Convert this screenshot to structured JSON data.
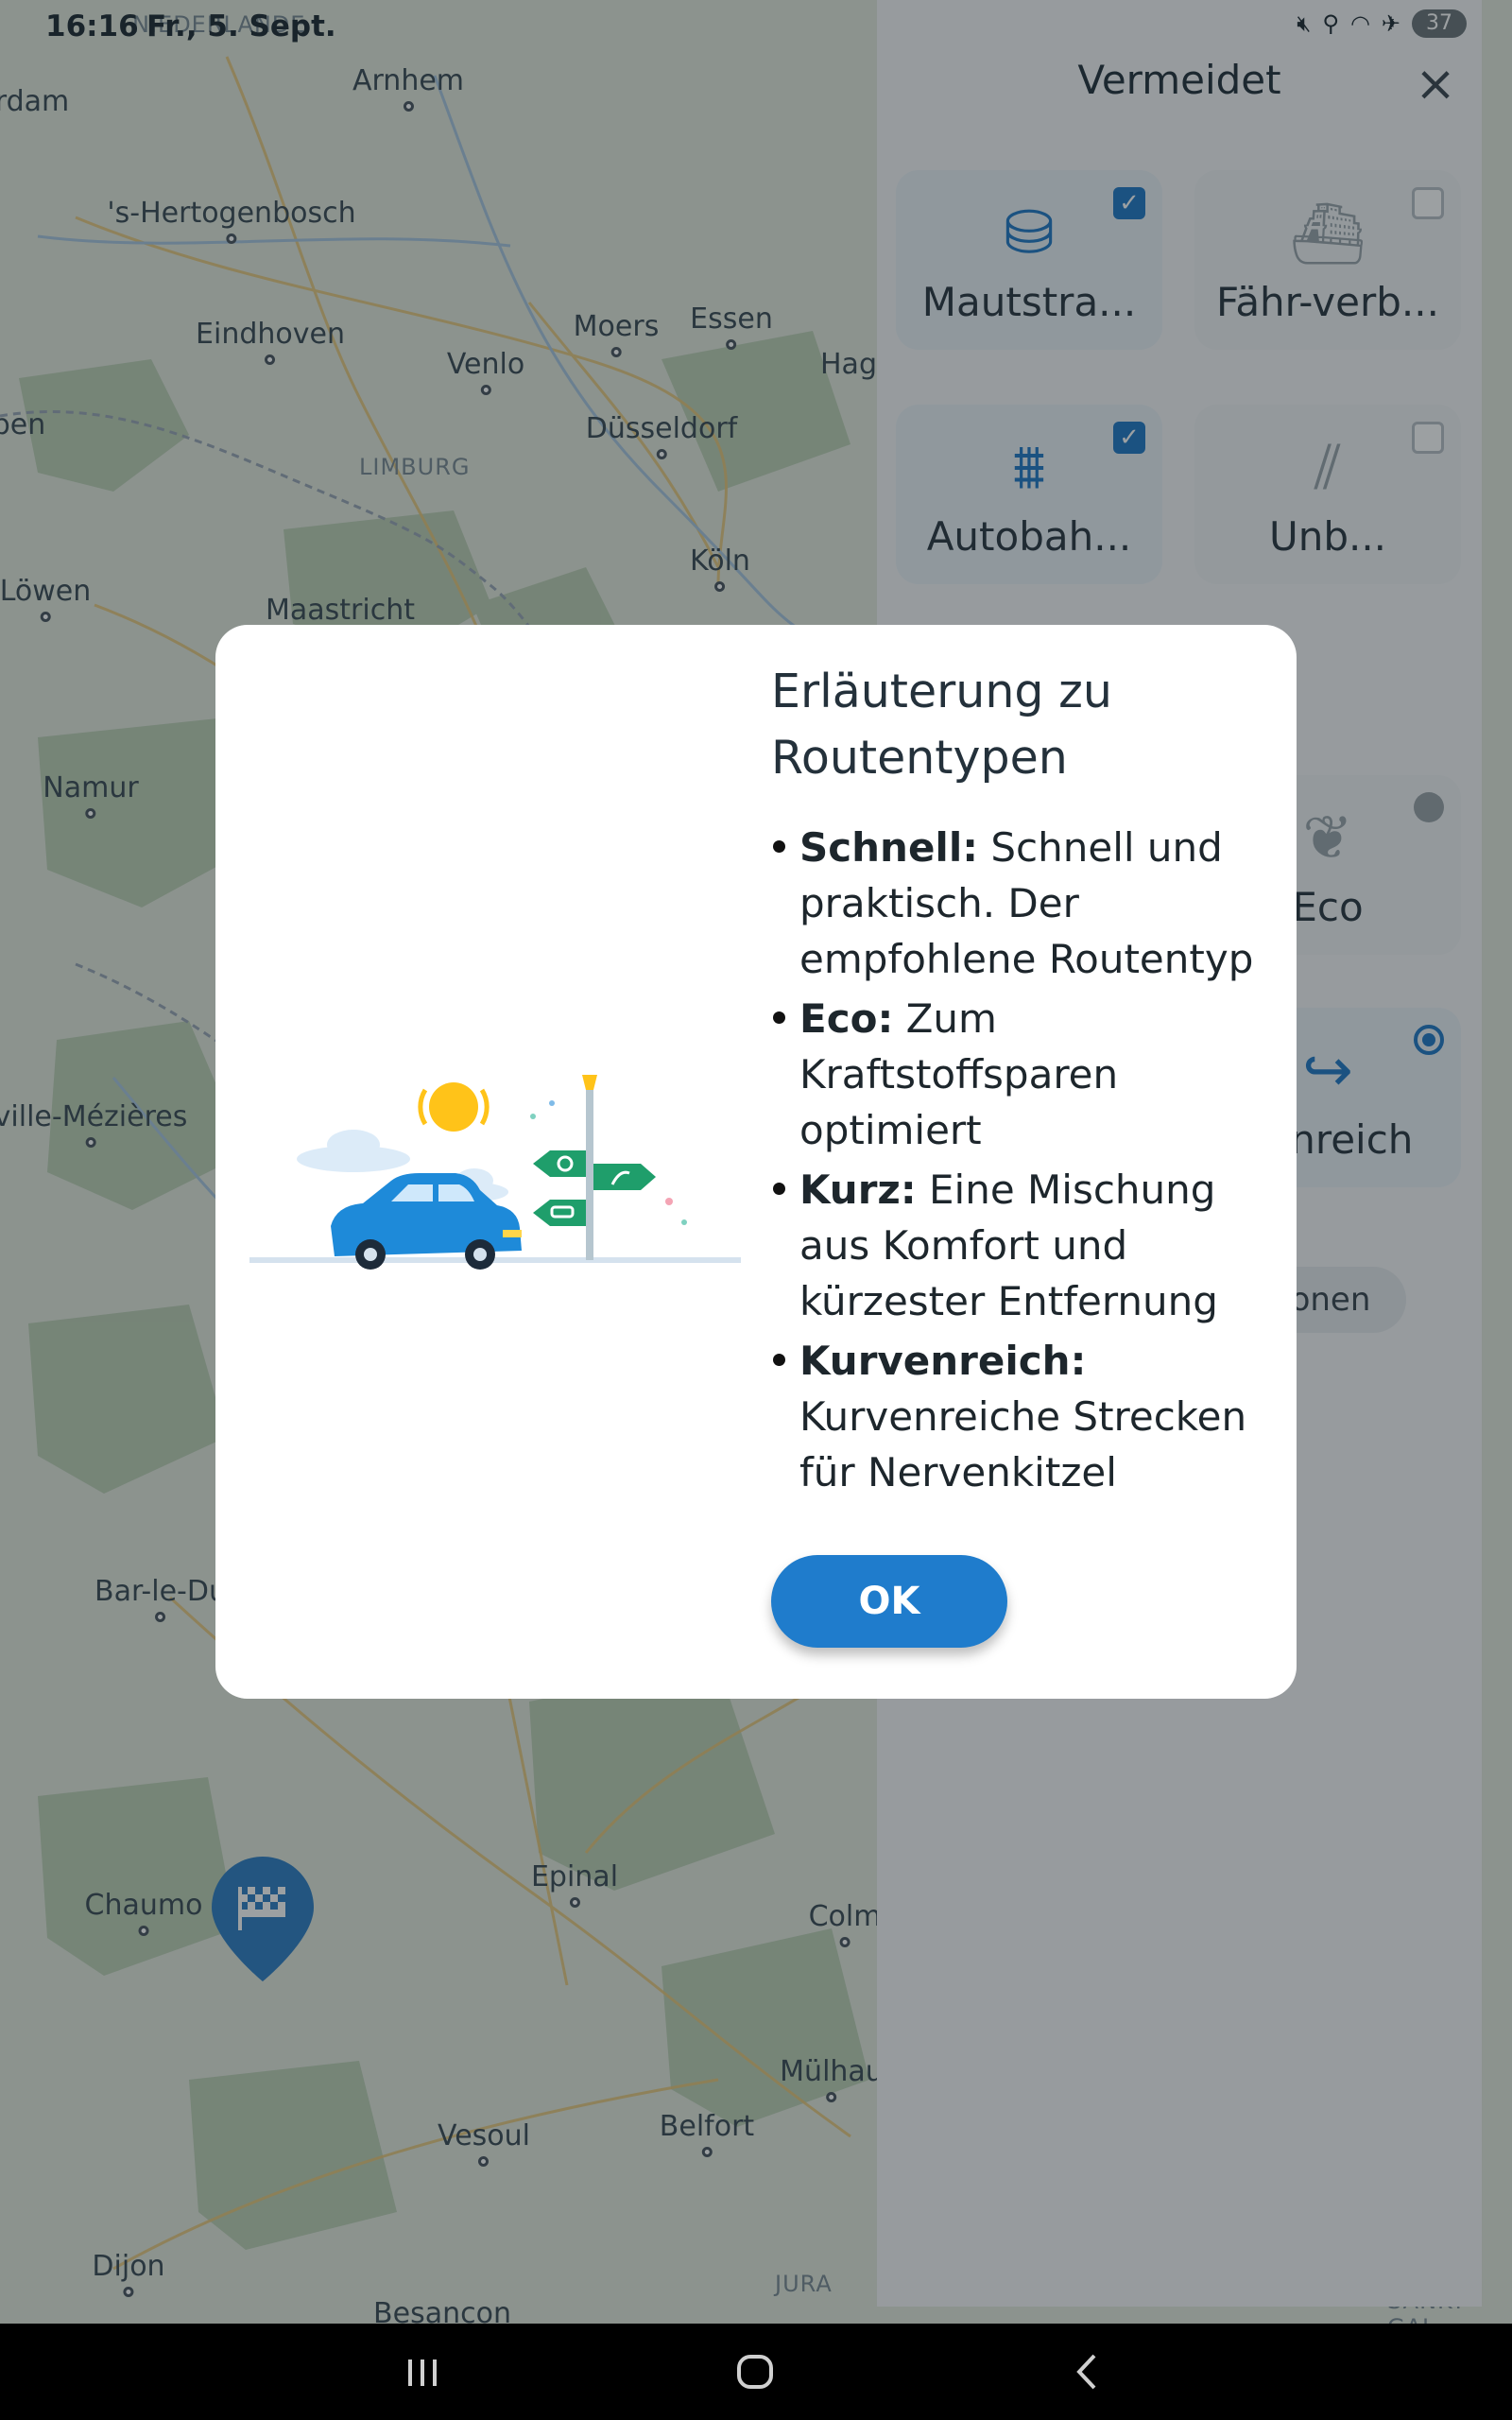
{
  "status_bar": {
    "time": "16:16",
    "date": "Fr., 5. Sept.",
    "battery": "37",
    "icons": [
      "mute-icon",
      "location-icon",
      "wifi-icon",
      "airplane-icon",
      "battery-icon"
    ]
  },
  "map": {
    "cities": [
      {
        "name": "Arnhem"
      },
      {
        "name": "'s-Hertogenbosch"
      },
      {
        "name": "Eindhoven"
      },
      {
        "name": "Moers"
      },
      {
        "name": "Essen"
      },
      {
        "name": "Venlo"
      },
      {
        "name": "Düsseldorf"
      },
      {
        "name": "Köln"
      },
      {
        "name": "Maastricht"
      },
      {
        "name": "Löwen"
      },
      {
        "name": "Namur"
      },
      {
        "name": "ville-Mézières"
      },
      {
        "name": "Bar-le-Du"
      },
      {
        "name": "Chaumo"
      },
      {
        "name": "Epinal"
      },
      {
        "name": "Colm"
      },
      {
        "name": "Mülhau"
      },
      {
        "name": "Belfort"
      },
      {
        "name": "Vesoul"
      },
      {
        "name": "Dijon"
      },
      {
        "name": "Besancon"
      },
      {
        "name": "rdam"
      },
      {
        "name": "pen"
      },
      {
        "name": "Hag"
      }
    ],
    "regions": [
      "NIEDERLANDE",
      "LIMBURG",
      "JURA",
      "SANKT GAL"
    ]
  },
  "panel": {
    "title": "Vermeidet",
    "avoid_options": [
      {
        "label": "Mautstra...",
        "checked": true,
        "icon": "toll-road-icon"
      },
      {
        "label": "Fähr-verb...",
        "checked": false,
        "icon": "ferry-icon"
      },
      {
        "label": "Autobah...",
        "checked": true,
        "icon": "highway-icon"
      },
      {
        "label": "Unb...",
        "checked": false,
        "icon": "unpaved-road-icon"
      }
    ],
    "route_options": [
      {
        "label": "Eco",
        "selected": false,
        "icon": "leaf-icon"
      },
      {
        "label": "venreich",
        "selected": true,
        "icon": "curvy-route-icon"
      }
    ],
    "more_label": "onen"
  },
  "dialog": {
    "title": "Erläuterung zu Routentypen",
    "items": [
      {
        "term": "Schnell:",
        "text": " Schnell und praktisch. Der empfohlene Routentyp"
      },
      {
        "term": "Eco:",
        "text": " Zum Kraftstoffsparen optimiert"
      },
      {
        "term": "Kurz:",
        "text": " Eine Mischung aus Komfort und kürzester Entfernung"
      },
      {
        "term": "Kurvenreich:",
        "text": " Kurvenreiche Strecken für Nervenkitzel"
      }
    ],
    "ok_label": "OK"
  },
  "colors": {
    "accent": "#1f7ccc",
    "panel_bg": "#f6f7f8",
    "scrim": "rgba(20,28,34,0.42)"
  }
}
